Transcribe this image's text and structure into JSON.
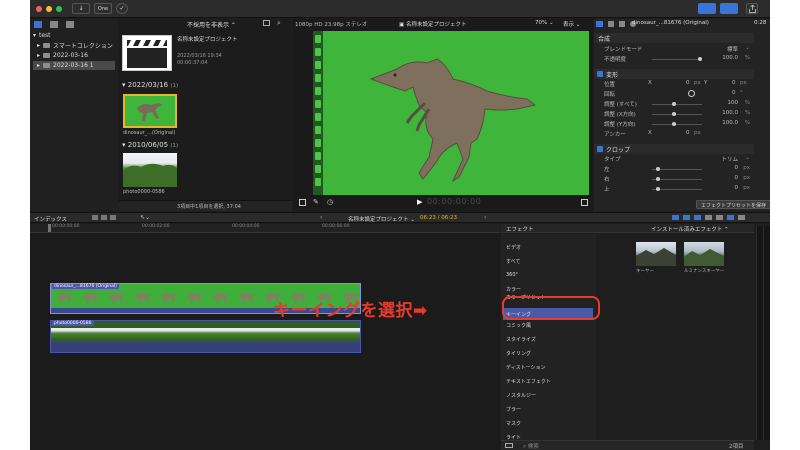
{
  "toolbar": {
    "btn_import": "↓",
    "btn_one": "One",
    "btn_check": "✓"
  },
  "library": {
    "items": [
      {
        "label": "test",
        "level": 0
      },
      {
        "label": "スマートコレクション",
        "level": 1
      },
      {
        "label": "2022-03-16",
        "level": 1
      },
      {
        "label": "2022-03-16 1",
        "level": 1,
        "selected": true
      }
    ]
  },
  "browser": {
    "filter_label": "不採用を非表示",
    "project_name": "名称未設定プロジェクト",
    "project_date": "2022/03/16 19:34",
    "project_duration": "00:00:37:04",
    "group1_date": "2022/03/16",
    "group1_count": "(1)",
    "clip1_name": "dinosaur_...(Original)",
    "group2_date": "2010/06/05",
    "group2_count": "(1)",
    "clip2_name": "photo0000-0586",
    "status": "3項目中1項目を選択, 37:04"
  },
  "viewer": {
    "format": "1080p HD 23.98p ステレオ",
    "title": "名称未設定プロジェクト",
    "zoom": "70%",
    "view_label": "表示",
    "timecode": "00:00:00:00"
  },
  "inspector": {
    "clip_name": "dinosaur_...81676 (Original)",
    "duration": "0:28",
    "sec_composite": "合成",
    "blend_label": "ブレンドモード",
    "blend_value": "標準",
    "opacity_label": "不透明度",
    "opacity_value": "100.0",
    "opacity_unit": "%",
    "sec_transform": "変形",
    "position_label": "位置",
    "pos_x_axis": "X",
    "pos_x": "0",
    "pos_x_unit": "px",
    "pos_y_axis": "Y",
    "pos_y": "0",
    "pos_y_unit": "px",
    "rotation_label": "回転",
    "rotation_value": "0",
    "rotation_unit": "°",
    "scale_all_label": "調整 (すべて)",
    "scale_all_value": "100",
    "scale_all_unit": "%",
    "scale_x_label": "調整 (X方向)",
    "scale_x_value": "100.0",
    "scale_x_unit": "%",
    "scale_y_label": "調整 (Y方向)",
    "scale_y_value": "100.0",
    "scale_y_unit": "%",
    "anchor_label": "アンカー",
    "anchor_x_axis": "X",
    "anchor_x": "0",
    "anchor_x_unit": "px",
    "sec_crop": "クロップ",
    "type_label": "タイプ",
    "type_value": "トリム",
    "crop_left_label": "左",
    "crop_left": "0",
    "crop_left_unit": "px",
    "crop_right_label": "右",
    "crop_right": "0",
    "crop_right_unit": "px",
    "crop_top_label": "上",
    "crop_top": "0",
    "crop_top_unit": "px",
    "save_preset": "エフェクトプリセットを保存"
  },
  "timeline": {
    "index_label": "インデックス",
    "project": "名称未設定プロジェクト",
    "time": "06:23 / 06:23",
    "ruler": [
      "00:00:00:00",
      "00:00:02:00",
      "00:00:04:00",
      "00:00:06:00"
    ],
    "clip1_label": "dinosaur_...81676 (Original)",
    "clip2_label": "photo0000-0586"
  },
  "effects": {
    "header": "エフェクト",
    "installed": "インストール済みエフェクト",
    "categories": [
      "ビデオ",
      "すべて",
      "360°",
      "カラー",
      "カラープリセット",
      "キーイング",
      "コミック風",
      "スタイライズ",
      "タイリング",
      "ディストーション",
      "テキストエフェクト",
      "ノスタルジー",
      "ブラー",
      "マスク",
      "ライト",
      "基本",
      "歪め"
    ],
    "selected_index": 5,
    "thumb1": "キーヤー",
    "thumb2": "ルミナンスキーヤー",
    "search_placeholder": "検索",
    "count": "2項目"
  },
  "annotation": {
    "text": "キーイングを選択➡"
  },
  "colors": {
    "accent": "#3b74d8",
    "green_screen": "#3fb53c",
    "annotation_red": "#e83b2c",
    "selected_effect": "#4a5aa8"
  }
}
